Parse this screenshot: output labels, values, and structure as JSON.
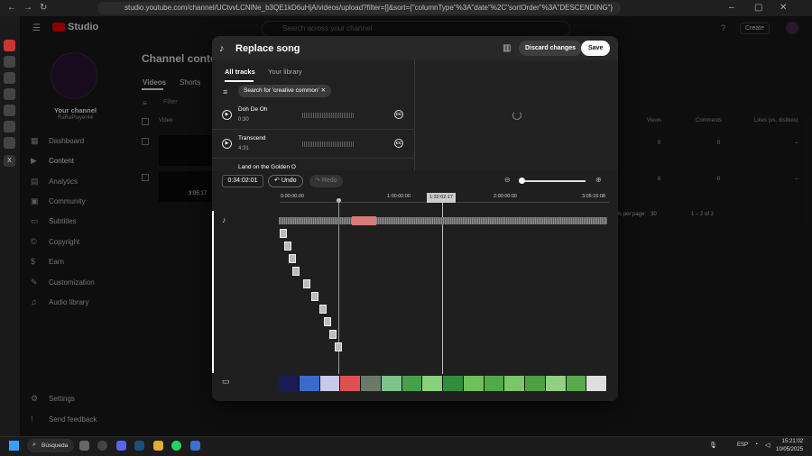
{
  "browser": {
    "url": "studio.youtube.com/channel/UCtvvLCNlNe_b3QE1kD6uHjA/videos/upload?filter=[]&sort={\"columnType\"%3A\"date\"%2C\"sortOrder\"%3A\"DESCENDING\"}"
  },
  "studio": {
    "logo": "Studio",
    "search_placeholder": "Search across your channel",
    "create_label": "Create",
    "channel_name": "Your channel",
    "channel_handle": "RaRaPlayer44",
    "nav": [
      {
        "label": "Dashboard",
        "icon": "dashboard-icon"
      },
      {
        "label": "Content",
        "icon": "content-icon"
      },
      {
        "label": "Analytics",
        "icon": "analytics-icon"
      },
      {
        "label": "Community",
        "icon": "community-icon"
      },
      {
        "label": "Subtitles",
        "icon": "subtitles-icon"
      },
      {
        "label": "Copyright",
        "icon": "copyright-icon"
      },
      {
        "label": "Earn",
        "icon": "earn-icon"
      },
      {
        "label": "Customization",
        "icon": "customization-icon"
      },
      {
        "label": "Audio library",
        "icon": "audio-library-icon"
      }
    ],
    "nav_bottom": [
      {
        "label": "Settings"
      },
      {
        "label": "Send feedback"
      }
    ],
    "page_title": "Channel content",
    "tabs": [
      "Videos",
      "Shorts"
    ],
    "filter_label": "Filter",
    "columns": {
      "video": "Video",
      "views": "Views",
      "comments": "Comments",
      "likes": "Likes (vs. dislikes)"
    },
    "rows": [
      {
        "views": "0",
        "comments": "0",
        "likes": "–",
        "duration": ""
      },
      {
        "views": "0",
        "comments": "0",
        "likes": "–",
        "duration": "3:05:17"
      }
    ],
    "pagination": {
      "rows_per_page_label": "Rows per page:",
      "rows_per_page": "30",
      "range": "1 – 2 of 2"
    }
  },
  "modal": {
    "title": "Replace song",
    "discard_label": "Discard changes",
    "save_label": "Save",
    "tabs": [
      "All tracks",
      "Your library"
    ],
    "search_chip": "Search for 'creative common'",
    "tracks": [
      {
        "name": "Doh De Oh",
        "duration": "0:30"
      },
      {
        "name": "Transcend",
        "duration": "4:31"
      },
      {
        "name": "Land on the Golden O",
        "duration": ""
      }
    ],
    "cc_label": "CC",
    "timeline": {
      "timecode": "0:34:02:01",
      "undo_label": "Undo",
      "redo_label": "Redo",
      "ruler": [
        "0:00:00:00",
        "1:00:00:00",
        "2:00:00:00",
        "3:05:16:08"
      ],
      "playhead": "1:32:02:17"
    }
  },
  "taskbar": {
    "search_label": "Búsqueda",
    "lang": "ESP",
    "time": "15:21:02",
    "date": "10/05/2025"
  }
}
